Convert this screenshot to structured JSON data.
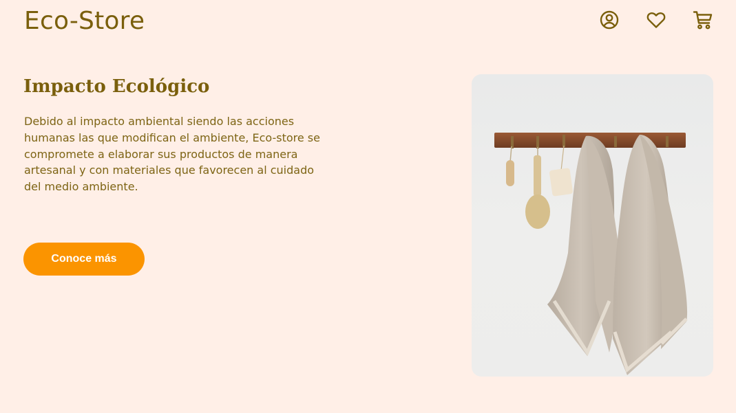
{
  "header": {
    "logo": "Eco-Store",
    "icons": [
      "user-circle-icon",
      "heart-icon",
      "cart-icon"
    ]
  },
  "hero": {
    "title": "Impacto Ecológico",
    "description": "Debido al impacto ambiental siendo las acciones humanas las que modifican el ambiente, Eco-store se compromete a elaborar sus productos de manera artesanal y con materiales que favorecen al cuidado del medio ambiente.",
    "cta_label": "Conoce más"
  },
  "colors": {
    "background": "#ffefe7",
    "brand_text": "#7a5f0c",
    "accent": "#fb9400"
  }
}
